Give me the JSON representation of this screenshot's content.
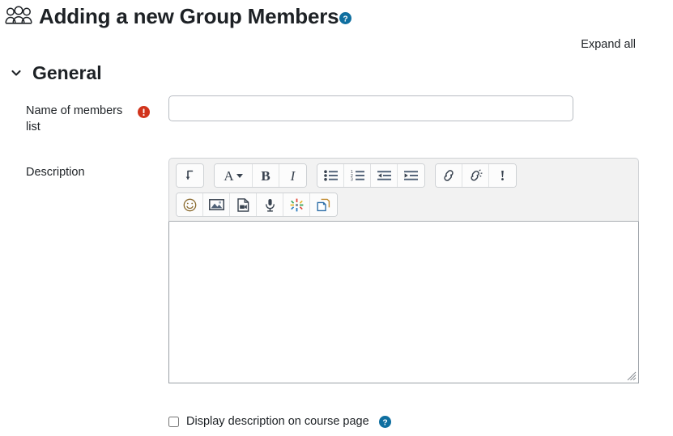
{
  "page": {
    "title": "Adding a new Group Members",
    "title_icon": "group-members-icon",
    "title_help_icon": "help-circle-icon",
    "expand_all_label": "Expand all"
  },
  "sections": {
    "general": {
      "label": "General",
      "collapse_icon": "chevron-down-icon",
      "expanded": true
    }
  },
  "fields": {
    "name": {
      "label": "Name of members list",
      "value": "",
      "placeholder": "",
      "required": true,
      "required_icon": "required-exclamation-icon"
    },
    "description": {
      "label": "Description",
      "value": "",
      "display_on_course_page": {
        "label": "Display description on course page",
        "checked": false,
        "help_icon": "help-circle-icon"
      }
    }
  },
  "editor": {
    "toolbar_rows": [
      [
        {
          "group": [
            {
              "name": "expand-toolbar-icon",
              "glyph": "arrow-down-hook",
              "label": "Expand toolbar"
            }
          ]
        },
        {
          "group": [
            {
              "name": "text-style-icon",
              "glyph": "A-caret",
              "label": "Styles"
            },
            {
              "name": "bold-icon",
              "glyph": "B",
              "label": "Bold"
            },
            {
              "name": "italic-icon",
              "glyph": "I",
              "label": "Italic"
            }
          ]
        },
        {
          "group": [
            {
              "name": "bullet-list-icon",
              "glyph": "unordered-list",
              "label": "Unordered list"
            },
            {
              "name": "numbered-list-icon",
              "glyph": "ordered-list",
              "label": "Ordered list"
            },
            {
              "name": "outdent-icon",
              "glyph": "outdent",
              "label": "Decrease indent"
            },
            {
              "name": "indent-icon",
              "glyph": "indent",
              "label": "Increase indent"
            }
          ]
        },
        {
          "group": [
            {
              "name": "link-icon",
              "glyph": "chain",
              "label": "Link"
            },
            {
              "name": "unlink-icon",
              "glyph": "broken-chain",
              "label": "Unlink"
            },
            {
              "name": "accessibility-checker-icon",
              "glyph": "!",
              "label": "Accessibility checker"
            }
          ]
        }
      ],
      [
        {
          "group": [
            {
              "name": "emoji-icon",
              "glyph": "smiley",
              "label": "Emoji picker"
            },
            {
              "name": "image-icon",
              "glyph": "picture",
              "label": "Insert image"
            },
            {
              "name": "media-icon",
              "glyph": "video-file",
              "label": "Insert media"
            },
            {
              "name": "record-audio-icon",
              "glyph": "microphone",
              "label": "Record audio"
            },
            {
              "name": "h5p-icon",
              "glyph": "color-starburst",
              "label": "Insert H5P content"
            },
            {
              "name": "manage-files-icon",
              "glyph": "copy-pages",
              "label": "Manage files"
            }
          ]
        }
      ]
    ]
  },
  "colors": {
    "text": "#1d2125",
    "help_icon": "#0f6fa0",
    "required_icon": "#d1341c",
    "toolbar_bg": "#f2f2f2",
    "border": "#ced1d4",
    "input_border": "#b8bcc2",
    "editor_border": "#9aa0a6"
  }
}
